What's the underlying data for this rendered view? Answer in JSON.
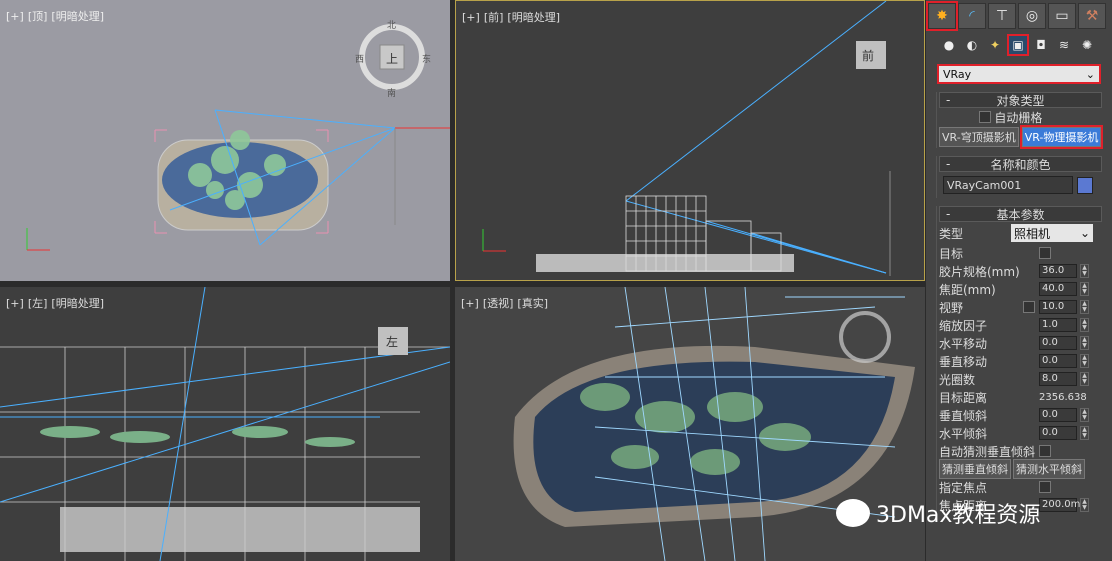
{
  "viewports": [
    {
      "plus": "[+]",
      "view": "[顶]",
      "shading": "[明暗处理]",
      "cube": "上",
      "compass": [
        "北",
        "南",
        "西",
        "东"
      ]
    },
    {
      "plus": "[+]",
      "view": "[前]",
      "shading": "[明暗处理]",
      "cube": "前"
    },
    {
      "plus": "[+]",
      "view": "[左]",
      "shading": "[明暗处理]",
      "cube": "左"
    },
    {
      "plus": "[+]",
      "view": "[透视]",
      "shading": "[真实]"
    }
  ],
  "command_panel": {
    "tabs": [
      "create",
      "modify",
      "hierarchy",
      "motion",
      "display",
      "utilities"
    ],
    "category_icons": [
      "geometry",
      "shapes",
      "lights",
      "cameras",
      "helpers",
      "space-warps",
      "systems"
    ],
    "dropdown": "VRay",
    "object_type": {
      "title": "对象类型",
      "auto_grid": "自动栅格",
      "buttons": [
        "VR-穹顶摄影机",
        "VR-物理摄影机"
      ]
    },
    "name_color": {
      "title": "名称和颜色",
      "name": "VRayCam001",
      "color": "#5b79d2"
    },
    "basic_params": {
      "title": "基本参数",
      "type_label": "类型",
      "type_value": "照相机",
      "target_label": "目标",
      "rows": [
        {
          "label": "胶片规格(mm)",
          "value": "36.0"
        },
        {
          "label": "焦距(mm)",
          "value": "40.0"
        },
        {
          "label": "视野",
          "value": "10.0"
        },
        {
          "label": "缩放因子",
          "value": "1.0"
        },
        {
          "label": "水平移动",
          "value": "0.0"
        },
        {
          "label": "垂直移动",
          "value": "0.0"
        },
        {
          "label": "光圈数",
          "value": "8.0"
        },
        {
          "label": "目标距离",
          "value": "2356.638"
        },
        {
          "label": "垂直倾斜",
          "value": "0.0"
        },
        {
          "label": "水平倾斜",
          "value": "0.0"
        }
      ],
      "auto_guess": "自动猜测垂直倾斜",
      "guess_v": "猜测垂直倾斜",
      "guess_h": "猜测水平倾斜",
      "focus_label": "指定焦点",
      "focus_dist_label": "焦点距离",
      "focus_dist": "200.0m"
    }
  },
  "watermark": "3DMax教程资源"
}
